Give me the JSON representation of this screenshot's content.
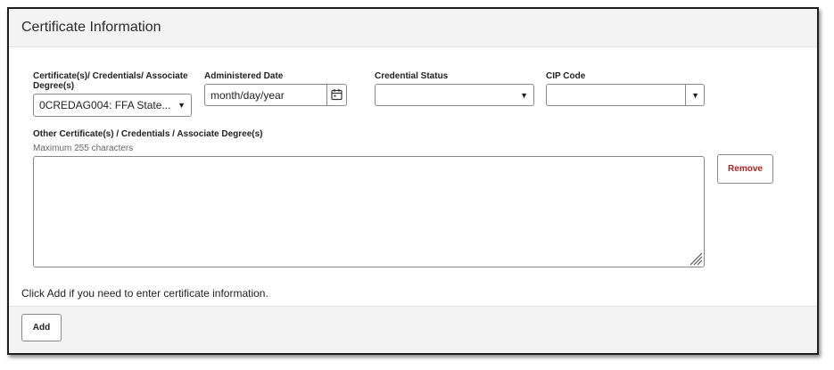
{
  "panel": {
    "title": "Certificate Information"
  },
  "fields": {
    "certificate": {
      "label": "Certificate(s)/ Credentials/ Associate Degree(s)",
      "value": "0CREDAG004: FFA State..."
    },
    "administered_date": {
      "label": "Administered Date",
      "value": "month/day/year"
    },
    "credential_status": {
      "label": "Credential Status",
      "value": ""
    },
    "cip_code": {
      "label": "CIP Code",
      "value": ""
    },
    "other_certificate": {
      "label": "Other Certificate(s) / Credentials / Associate Degree(s)",
      "hint": "Maximum 255 characters",
      "value": ""
    }
  },
  "buttons": {
    "remove_label": "Remove",
    "add_label": "Add"
  },
  "info_text": "Click Add if you need to enter certificate information.",
  "colors": {
    "remove_text": "#b02020",
    "header_bg": "#f3f3f3"
  },
  "icons": {
    "calendar": "calendar-icon",
    "dropdown": "chevron-down-icon",
    "resize": "resize-grip-icon"
  }
}
